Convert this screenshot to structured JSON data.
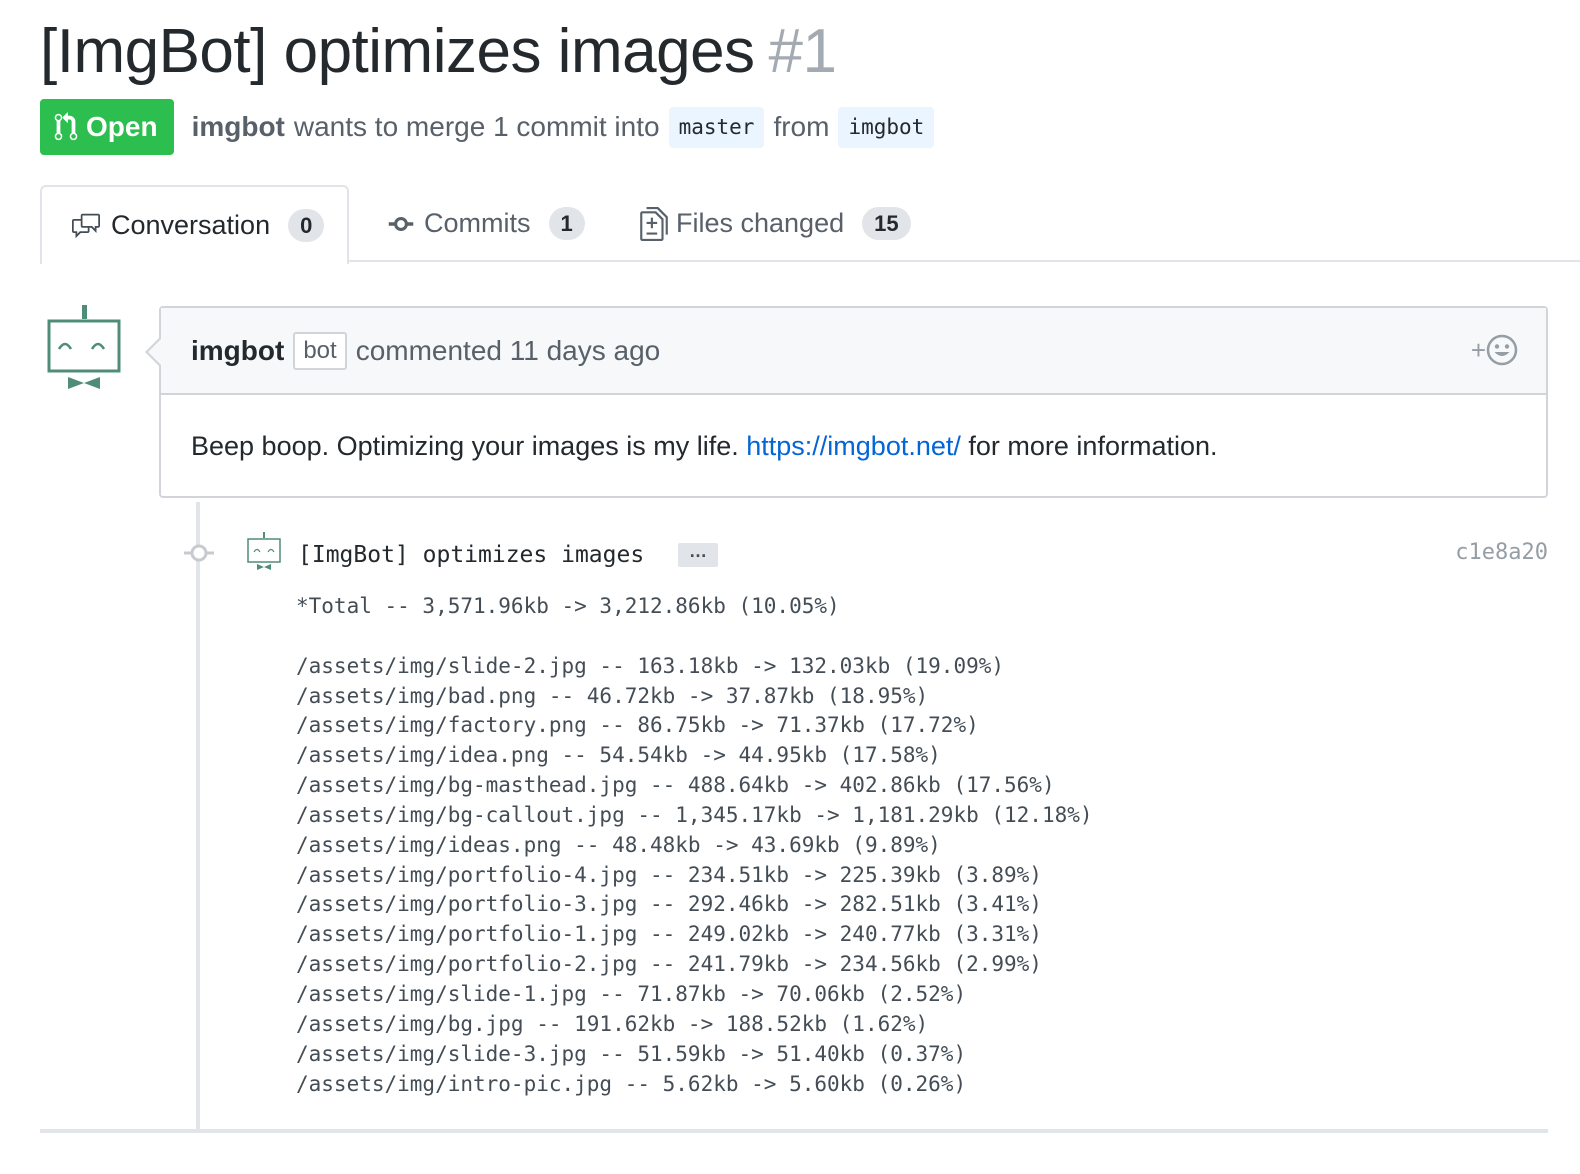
{
  "pr": {
    "title": "[ImgBot] optimizes images",
    "number": "#1",
    "state": "Open",
    "author": "imgbot",
    "merge_text": "wants to merge 1 commit into",
    "base_branch": "master",
    "from_text": "from",
    "head_branch": "imgbot"
  },
  "tabs": [
    {
      "label": "Conversation",
      "count": "0",
      "icon": "comment-discussion-icon"
    },
    {
      "label": "Commits",
      "count": "1",
      "icon": "git-commit-icon"
    },
    {
      "label": "Files changed",
      "count": "15",
      "icon": "diff-icon"
    }
  ],
  "comment": {
    "author": "imgbot",
    "label": "bot",
    "action": "commented 11 days ago",
    "body_text": "Beep boop. Optimizing your images is my life.",
    "link": "https://imgbot.net/",
    "body_suffix": "for more information.",
    "reaction_plus": "+"
  },
  "commit": {
    "title": "[ImgBot] optimizes images",
    "ellipsis": "…",
    "sha": "c1e8a20",
    "description": "*Total -- 3,571.96kb -> 3,212.86kb (10.05%)\n\n/assets/img/slide-2.jpg -- 163.18kb -> 132.03kb (19.09%)\n/assets/img/bad.png -- 46.72kb -> 37.87kb (18.95%)\n/assets/img/factory.png -- 86.75kb -> 71.37kb (17.72%)\n/assets/img/idea.png -- 54.54kb -> 44.95kb (17.58%)\n/assets/img/bg-masthead.jpg -- 488.64kb -> 402.86kb (17.56%)\n/assets/img/bg-callout.jpg -- 1,345.17kb -> 1,181.29kb (12.18%)\n/assets/img/ideas.png -- 48.48kb -> 43.69kb (9.89%)\n/assets/img/portfolio-4.jpg -- 234.51kb -> 225.39kb (3.89%)\n/assets/img/portfolio-3.jpg -- 292.46kb -> 282.51kb (3.41%)\n/assets/img/portfolio-1.jpg -- 249.02kb -> 240.77kb (3.31%)\n/assets/img/portfolio-2.jpg -- 241.79kb -> 234.56kb (2.99%)\n/assets/img/slide-1.jpg -- 71.87kb -> 70.06kb (2.52%)\n/assets/img/bg.jpg -- 191.62kb -> 188.52kb (1.62%)\n/assets/img/slide-3.jpg -- 51.59kb -> 51.40kb (0.37%)\n/assets/img/intro-pic.jpg -- 5.62kb -> 5.60kb (0.26%)"
  },
  "colors": {
    "open_green": "#2cbe4e",
    "link_blue": "#0366d6",
    "bot_teal": "#4f8c7a"
  }
}
